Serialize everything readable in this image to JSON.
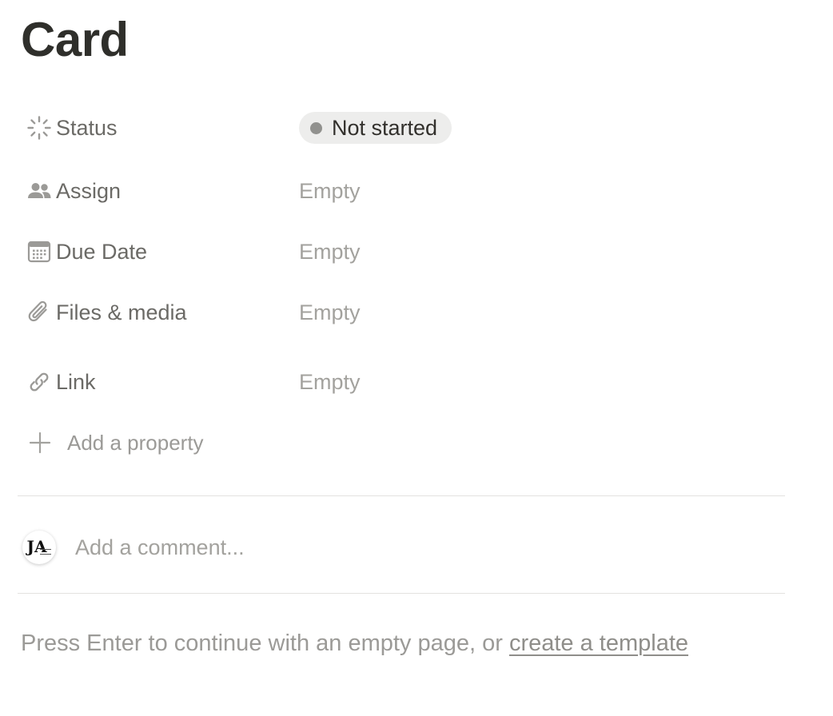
{
  "page": {
    "title": "Card"
  },
  "properties": [
    {
      "label": "Status",
      "icon": "status-icon",
      "value": "Not started",
      "type": "status"
    },
    {
      "label": "Assign",
      "icon": "people-icon",
      "value": "Empty",
      "type": "person"
    },
    {
      "label": "Due Date",
      "icon": "calendar-icon",
      "value": "Empty",
      "type": "date"
    },
    {
      "label": "Files & media",
      "icon": "paperclip-icon",
      "value": "Empty",
      "type": "files"
    },
    {
      "label": "Link",
      "icon": "link-icon",
      "value": "Empty",
      "type": "url"
    }
  ],
  "add_property": {
    "label": "Add a property",
    "icon": "plus-icon"
  },
  "comment": {
    "placeholder": "Add a comment...",
    "avatar_initials": "JA"
  },
  "footer": {
    "text": "Press Enter to continue with an empty page, or ",
    "link_label": "create a template"
  },
  "colors": {
    "status_pill_bg": "#ededec",
    "status_dot": "#91918e",
    "muted_text": "#a3a29e",
    "label_text": "#6b6a66"
  }
}
